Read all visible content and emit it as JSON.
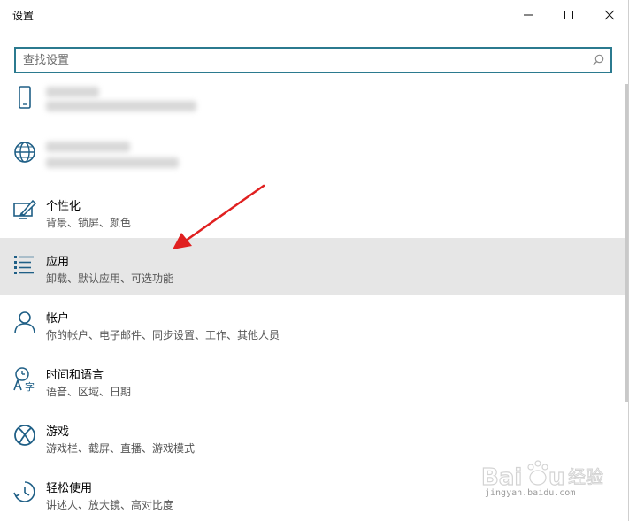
{
  "window": {
    "title": "设置"
  },
  "search": {
    "placeholder": "查找设置",
    "value": ""
  },
  "items": [
    {
      "name": "个性化",
      "desc": "背景、锁屏、颜色",
      "icon": "personalization-icon"
    },
    {
      "name": "应用",
      "desc": "卸载、默认应用、可选功能",
      "icon": "apps-icon"
    },
    {
      "name": "帐户",
      "desc": "你的帐户、电子邮件、同步设置、工作、其他人员",
      "icon": "account-icon"
    },
    {
      "name": "时间和语言",
      "desc": "语音、区域、日期",
      "icon": "time-language-icon"
    },
    {
      "name": "游戏",
      "desc": "游戏栏、截屏、直播、游戏模式",
      "icon": "xbox-icon"
    },
    {
      "name": "轻松使用",
      "desc": "讲述人、放大镜、高对比度",
      "icon": "ease-of-access-icon"
    }
  ],
  "watermark": {
    "text": "jingyan.baidu.com"
  },
  "colors": {
    "accent": "#1f5f86",
    "search_border": "#2b7a8f",
    "selected_bg": "#e6e6e6",
    "annotation_arrow": "#e02020"
  }
}
